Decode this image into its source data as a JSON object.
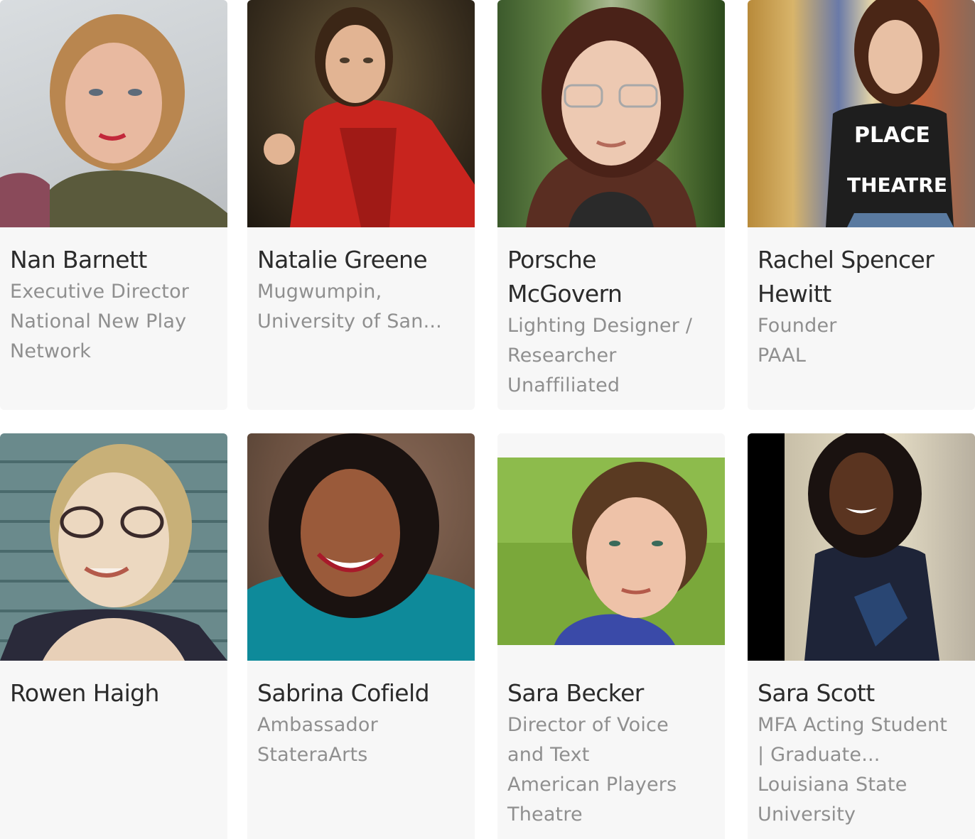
{
  "people": [
    {
      "name": "Nan Barnett",
      "lines": [
        "Executive Director",
        "National New Play",
        "Network"
      ],
      "photo": "portrait-photo"
    },
    {
      "name": "Natalie Greene",
      "lines": [
        "Mugwumpin,",
        "University of San..."
      ],
      "photo": "portrait-photo"
    },
    {
      "name": "Porsche McGovern",
      "lines": [
        "Lighting Designer /",
        "Researcher",
        "Unaffiliated"
      ],
      "photo": "portrait-photo"
    },
    {
      "name": "Rachel Spencer Hewitt",
      "lines": [
        "Founder",
        "PAAL"
      ],
      "photo": "portrait-photo"
    },
    {
      "name": "Rowen Haigh",
      "lines": [],
      "photo": "portrait-photo"
    },
    {
      "name": "Sabrina Cofield",
      "lines": [
        "Ambassador",
        "StateraArts"
      ],
      "photo": "portrait-photo"
    },
    {
      "name": "Sara Becker",
      "lines": [
        "Director of Voice",
        "and Text",
        "American Players",
        "Theatre"
      ],
      "photo": "portrait-photo"
    },
    {
      "name": "Sara Scott",
      "lines": [
        "MFA Acting Student",
        "| Graduate...",
        "Louisiana State",
        "University"
      ],
      "photo": "portrait-photo"
    }
  ],
  "colors": {
    "card_bg": "#f7f7f7",
    "name_text": "#2b2b2b",
    "detail_text": "#8f8f8f"
  }
}
